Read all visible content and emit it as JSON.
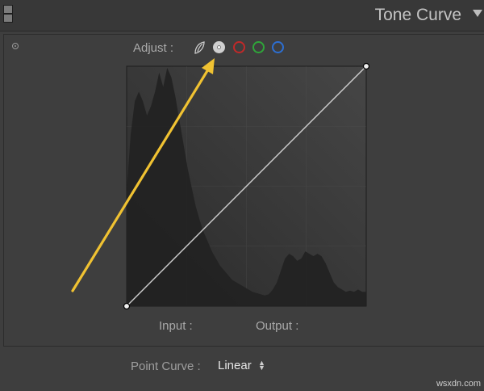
{
  "header": {
    "title": "Tone Curve",
    "collapse_icon": "triangle-down-icon",
    "panel_switch_icon": "panel-switch-icon"
  },
  "adjust": {
    "label": "Adjust :",
    "channels": [
      {
        "name": "rgb-composite",
        "icon": "rgb-icon",
        "color": "#cfcfcf",
        "selected": false
      },
      {
        "name": "white",
        "icon": "luminance-dot-icon",
        "color": "#ffffff",
        "selected": true
      },
      {
        "name": "red",
        "icon": "circle-icon",
        "color": "#c12929",
        "selected": false
      },
      {
        "name": "green",
        "icon": "circle-icon",
        "color": "#2fa53a",
        "selected": false
      },
      {
        "name": "blue",
        "icon": "circle-icon",
        "color": "#2d6fd2",
        "selected": false
      }
    ]
  },
  "graph": {
    "curve_type": "linear",
    "control_points": [
      [
        0,
        0
      ],
      [
        255,
        255
      ]
    ],
    "histogram_profile": [
      0.48,
      0.72,
      0.86,
      0.9,
      0.86,
      0.8,
      0.84,
      0.9,
      0.98,
      0.92,
      1.0,
      0.96,
      0.88,
      0.78,
      0.68,
      0.58,
      0.5,
      0.42,
      0.36,
      0.31,
      0.27,
      0.23,
      0.2,
      0.17,
      0.15,
      0.13,
      0.11,
      0.1,
      0.09,
      0.08,
      0.07,
      0.06,
      0.055,
      0.05,
      0.045,
      0.05,
      0.07,
      0.1,
      0.15,
      0.2,
      0.22,
      0.21,
      0.19,
      0.2,
      0.23,
      0.22,
      0.21,
      0.22,
      0.21,
      0.18,
      0.14,
      0.1,
      0.08,
      0.07,
      0.06,
      0.065,
      0.06,
      0.07,
      0.06,
      0.06
    ],
    "arrow_color": "#f0c232"
  },
  "io": {
    "input_label": "Input :",
    "output_label": "Output :"
  },
  "point_curve": {
    "label": "Point Curve :",
    "value": "Linear",
    "icon": "updown-arrows-icon"
  },
  "watermark": "wsxdn.com"
}
